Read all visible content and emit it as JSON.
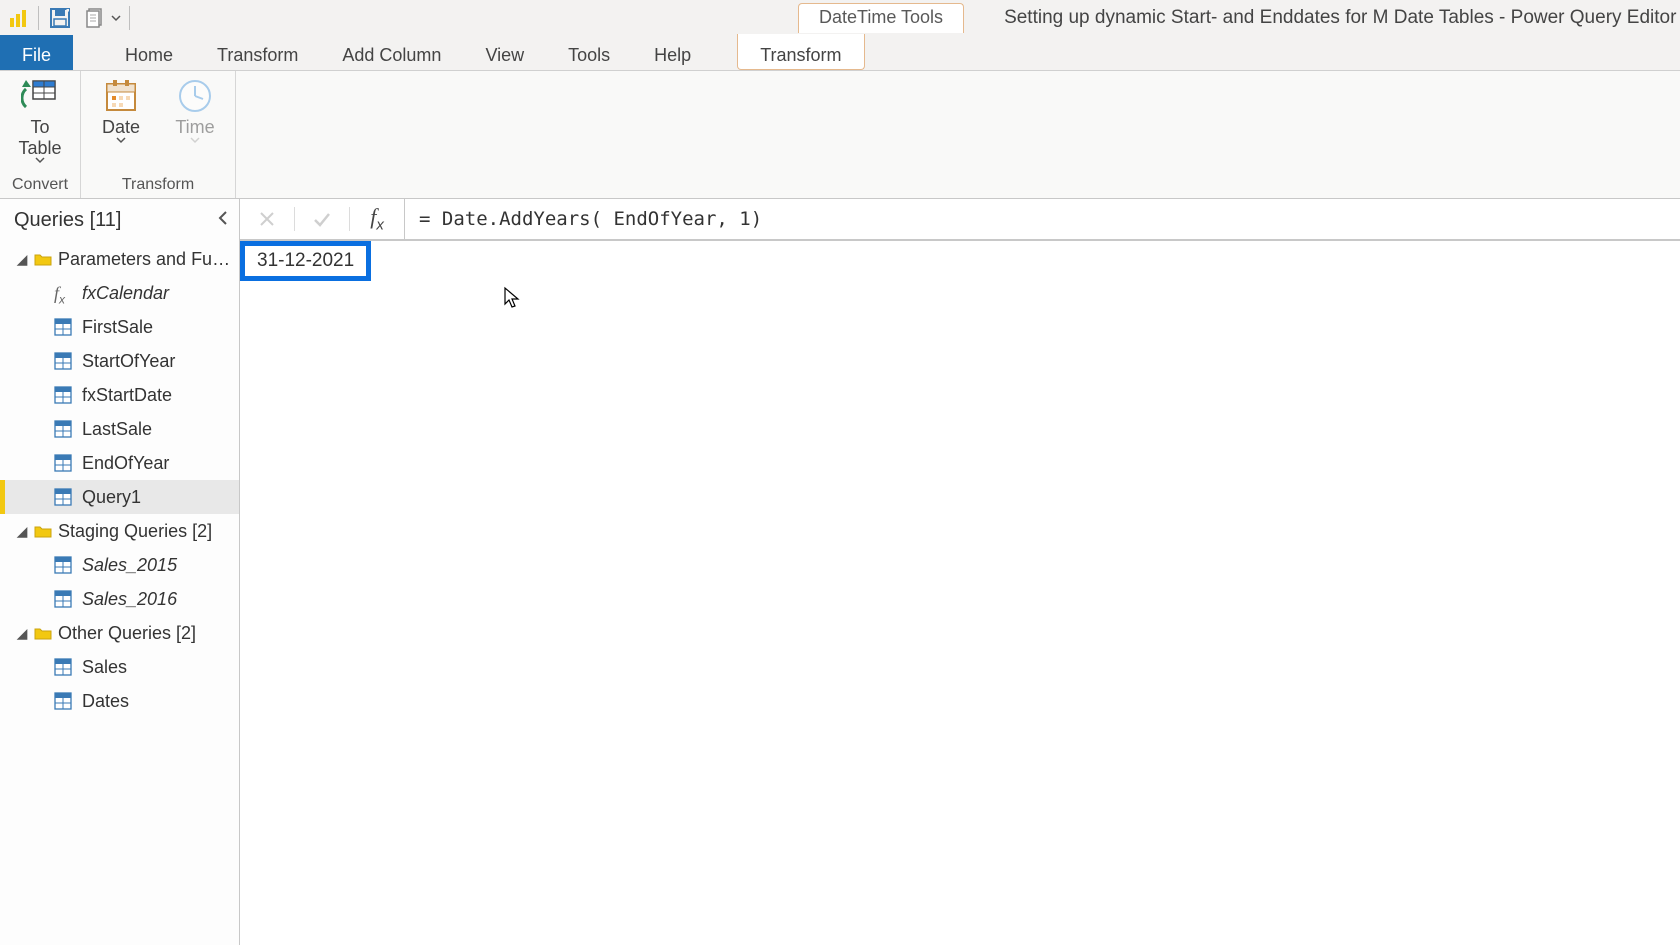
{
  "qat": {
    "save_name": "save",
    "undo_name": "undo"
  },
  "context_tab_group": "DateTime Tools",
  "window_title": "Setting up dynamic Start- and Enddates for M Date Tables - Power Query Editor",
  "tabs": {
    "file": "File",
    "home": "Home",
    "transform": "Transform",
    "add_column": "Add Column",
    "view": "View",
    "tools": "Tools",
    "help": "Help",
    "context_transform": "Transform"
  },
  "ribbon": {
    "convert": {
      "group_label": "Convert",
      "to_table": "To\nTable"
    },
    "transform": {
      "group_label": "Transform",
      "date": "Date",
      "time": "Time"
    }
  },
  "sidebar": {
    "title": "Queries [11]",
    "groups": [
      {
        "label": "Parameters and Fu…",
        "expanded": true,
        "items": [
          {
            "label": "fxCalendar",
            "icon": "fx",
            "italic": true,
            "selected": false
          },
          {
            "label": "FirstSale",
            "icon": "table",
            "italic": false,
            "selected": false
          },
          {
            "label": "StartOfYear",
            "icon": "table",
            "italic": false,
            "selected": false
          },
          {
            "label": "fxStartDate",
            "icon": "table",
            "italic": false,
            "selected": false
          },
          {
            "label": "LastSale",
            "icon": "table",
            "italic": false,
            "selected": false
          },
          {
            "label": "EndOfYear",
            "icon": "table",
            "italic": false,
            "selected": false
          },
          {
            "label": "Query1",
            "icon": "table",
            "italic": false,
            "selected": true
          }
        ]
      },
      {
        "label": "Staging Queries [2]",
        "expanded": true,
        "items": [
          {
            "label": "Sales_2015",
            "icon": "table",
            "italic": true,
            "selected": false
          },
          {
            "label": "Sales_2016",
            "icon": "table",
            "italic": true,
            "selected": false
          }
        ]
      },
      {
        "label": "Other Queries [2]",
        "expanded": true,
        "items": [
          {
            "label": "Sales",
            "icon": "table",
            "italic": false,
            "selected": false
          },
          {
            "label": "Dates",
            "icon": "table",
            "italic": false,
            "selected": false
          }
        ]
      }
    ]
  },
  "formula": "= Date.AddYears( EndOfYear, 1)",
  "result_value": "31-12-2021"
}
